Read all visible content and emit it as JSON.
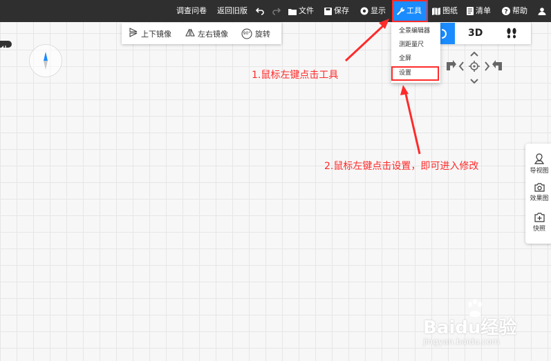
{
  "topbar": {
    "survey": "调查问卷",
    "return_old": "返回旧版",
    "file": "文件",
    "save": "保存",
    "display": "显示",
    "tools": "工具",
    "drawings": "图纸",
    "list": "清单",
    "help": "帮助"
  },
  "subtoolbar": {
    "flip_vertical": "上下镜像",
    "flip_horizontal": "左右镜像",
    "rotate_badge": "90°",
    "rotate": "旋转"
  },
  "viewbar": {
    "mode_3d": "3D"
  },
  "tools_menu": {
    "items": [
      "全景编辑器",
      "测距量尺",
      "全屏",
      "设置"
    ]
  },
  "annotations": {
    "step1": "1.鼠标左键点击工具",
    "step2": "2.鼠标左键点击设置，即可进入修改"
  },
  "side_panel": {
    "guide_view": "导视图",
    "render": "效果图",
    "snapshot": "快照"
  },
  "watermark": {
    "brand": "Baidu经验",
    "url": "jingyan.baidu.com"
  },
  "colors": {
    "accent": "#1a8cff",
    "annotation": "#ff2a2a",
    "topbar": "#2f2f2f"
  }
}
